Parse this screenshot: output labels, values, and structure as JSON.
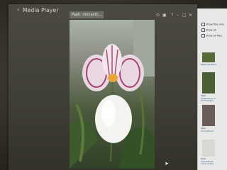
{
  "window": {
    "back_icon": "back-chevron-icon",
    "title": "Media Player",
    "tab_label": "Paph. micranth..."
  },
  "window_controls": [
    "info-icon",
    "gallery-icon",
    "help-icon",
    "minimize-icon",
    "restore-icon",
    "close-icon"
  ],
  "side_panel": {
    "options": [
      "Show files only",
      "Show all",
      "Show all files"
    ],
    "items": [
      {
        "label": "Paphiopedilum"
      },
      {
        "label": "Paph. malipoense in Champagne"
      },
      {
        "label": "Paph. micranthum"
      },
      {
        "label": "Paph. micranthum Lotus Glade"
      }
    ]
  },
  "colors": {
    "panel_bg": "#e8e8e6",
    "tab_bg": "#6e6d66",
    "link": "#2e5a86"
  }
}
